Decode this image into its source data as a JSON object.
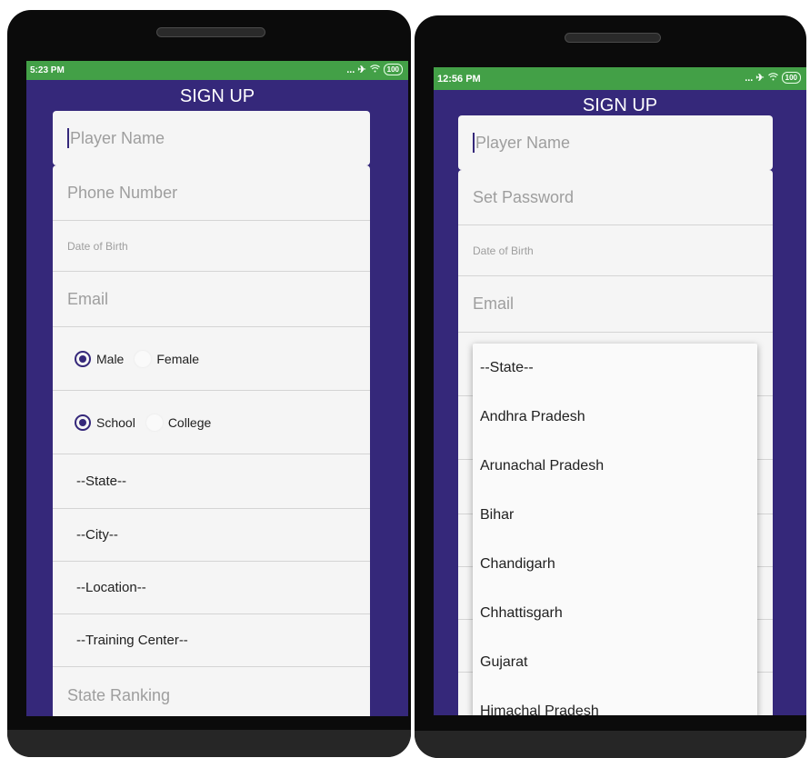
{
  "left_phone": {
    "status": {
      "time": "5:23 PM",
      "signal": "... ✈",
      "battery": "100"
    },
    "title": "SIGN UP",
    "fields": {
      "player_name_placeholder": "Player Name",
      "phone_placeholder": "Phone Number",
      "dob_placeholder": "Date of Birth",
      "email_placeholder": "Email",
      "gender": {
        "selected": "Male",
        "options": [
          "Male",
          "Female"
        ]
      },
      "institution": {
        "selected": "School",
        "options": [
          "School",
          "College"
        ]
      },
      "state_select": "--State--",
      "city_select": "--City--",
      "location_select": "--Location--",
      "training_center_select": "--Training Center--",
      "state_ranking_placeholder": "State Ranking"
    }
  },
  "right_phone": {
    "status": {
      "time": "12:56 PM",
      "signal": "... ✈",
      "battery": "100"
    },
    "title": "SIGN UP",
    "fields": {
      "player_name_placeholder": "Player Name",
      "password_placeholder": "Set Password",
      "dob_placeholder": "Date of Birth",
      "email_placeholder": "Email"
    },
    "state_dropdown": {
      "items": [
        "--State--",
        "Andhra Pradesh",
        "Arunachal Pradesh",
        "Bihar",
        "Chandigarh",
        "Chhattisgarh",
        "Gujarat",
        "Himachal Pradesh"
      ]
    }
  },
  "colors": {
    "screen_bg": "#35287a",
    "status_bar": "#43a047",
    "card_bg": "#f5f5f5"
  }
}
